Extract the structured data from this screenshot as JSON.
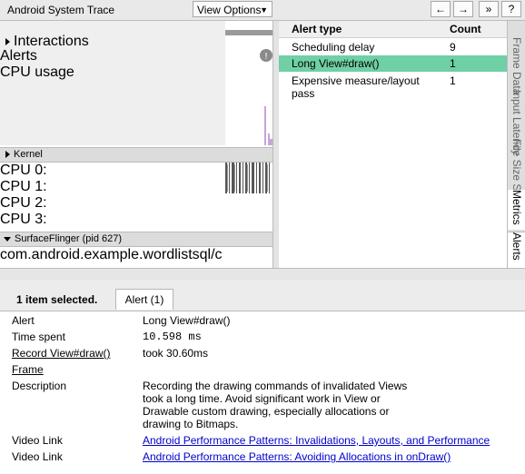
{
  "titlebar": {
    "title": "Android System Trace",
    "view_options_label": "View Options",
    "nav": {
      "back": "←",
      "forward": "→",
      "expand": "»",
      "help": "?"
    }
  },
  "tracks": {
    "interactions_label": "Interactions",
    "alerts_label": "Alerts",
    "cpu_usage_label": "CPU usage",
    "kernel_label": "Kernel",
    "cpus": [
      "CPU 0:",
      "CPU 1:",
      "CPU 2:",
      "CPU 3:"
    ],
    "process_label": "SurfaceFlinger (pid 627)",
    "process_thread": "com.android.example.wordlistsql/c"
  },
  "alert_table": {
    "headers": {
      "type": "Alert type",
      "count": "Count"
    },
    "rows": [
      {
        "type": "Scheduling delay",
        "count": "9",
        "selected": false
      },
      {
        "type": "Long View#draw()",
        "count": "1",
        "selected": true
      },
      {
        "type": "Expensive measure/layout pass",
        "count": "1",
        "selected": false
      }
    ]
  },
  "side_tabs": [
    "Frame Data",
    "Input Latency",
    "File Size Stats",
    "Metrics",
    "Alerts"
  ],
  "bottom": {
    "selection_count": "1 item selected.",
    "tab_label": "Alert (1)",
    "details": {
      "alert_label": "Alert",
      "alert_value": "Long View#draw()",
      "time_label": "Time spent",
      "time_value": "10.598 ms",
      "record_label": "Record View#draw()",
      "record_value": "took 30.60ms",
      "frame_label": "Frame",
      "description_label": "Description",
      "description_lines": [
        "Recording the drawing commands of invalidated Views",
        "took a long time. Avoid significant work in View or",
        "Drawable custom drawing, especially allocations or",
        "drawing to Bitmaps."
      ],
      "video_label_1": "Video Link",
      "video_link_1": "Android Performance Patterns: Invalidations, Layouts, and Performance",
      "video_label_2": "Video Link",
      "video_link_2": "Android Performance Patterns: Avoiding Allocations in onDraw()"
    }
  },
  "colors": {
    "selected_row": "#6fcfa5",
    "cpu_usage_bar": "#c9a3d3",
    "link": "#0000cc"
  }
}
